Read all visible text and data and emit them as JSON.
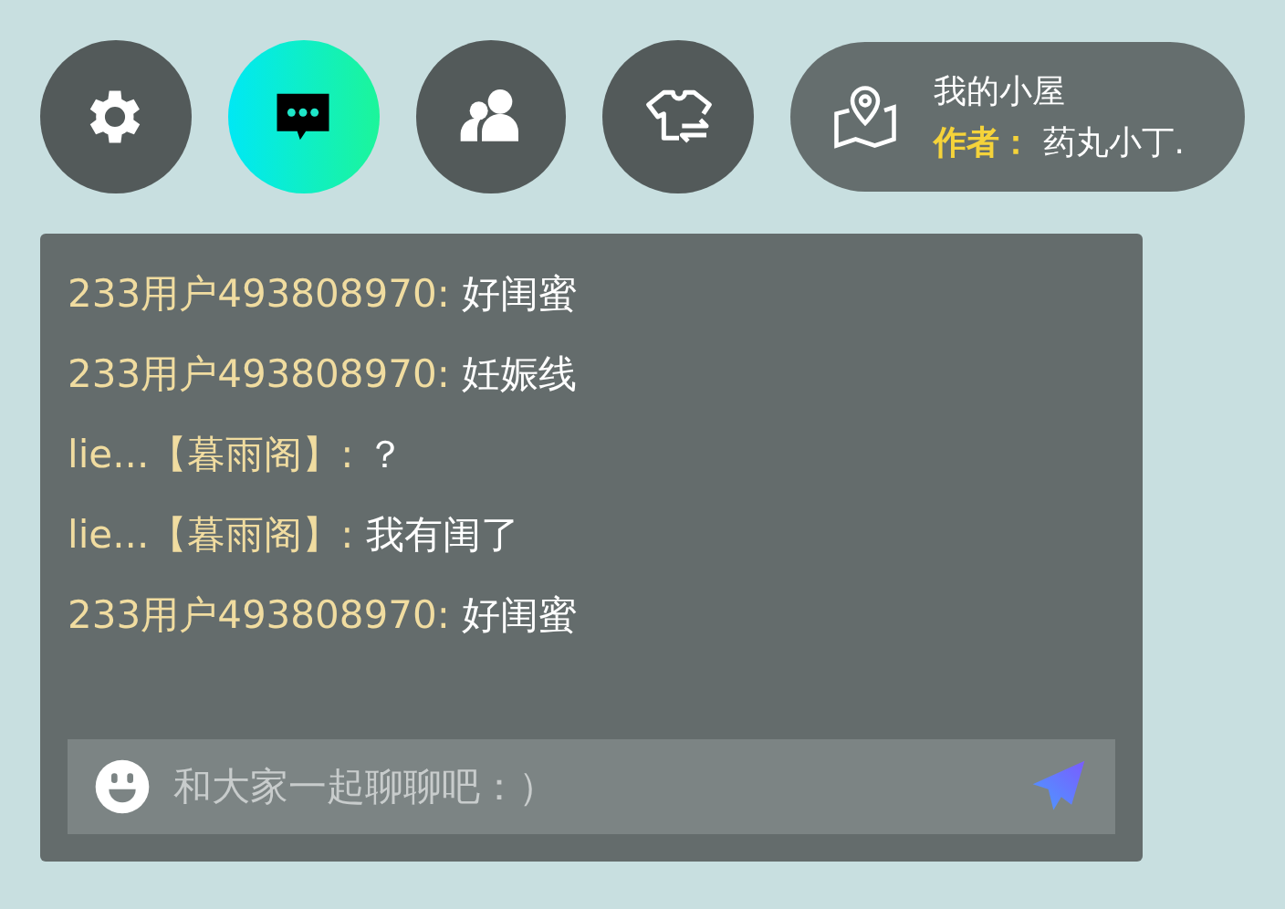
{
  "toolbar": [
    {
      "kind": "settings",
      "selected": false
    },
    {
      "kind": "chat",
      "selected": true
    },
    {
      "kind": "friends",
      "selected": false
    },
    {
      "kind": "outfit",
      "selected": false
    }
  ],
  "room": {
    "name": "我的小屋",
    "author_label": "作者：",
    "author": "药丸小丁."
  },
  "chat": {
    "messages": [
      {
        "sender": "233用户493808970:",
        "text": "好闺蜜"
      },
      {
        "sender": "233用户493808970:",
        "text": "妊娠线"
      },
      {
        "sender": "lie...【暮雨阁】:",
        "text": "？"
      },
      {
        "sender": "lie...【暮雨阁】:",
        "text": "我有闺了"
      },
      {
        "sender": "233用户493808970:",
        "text": "好闺蜜"
      }
    ],
    "input": {
      "placeholder": "和大家一起聊聊吧：）"
    }
  }
}
